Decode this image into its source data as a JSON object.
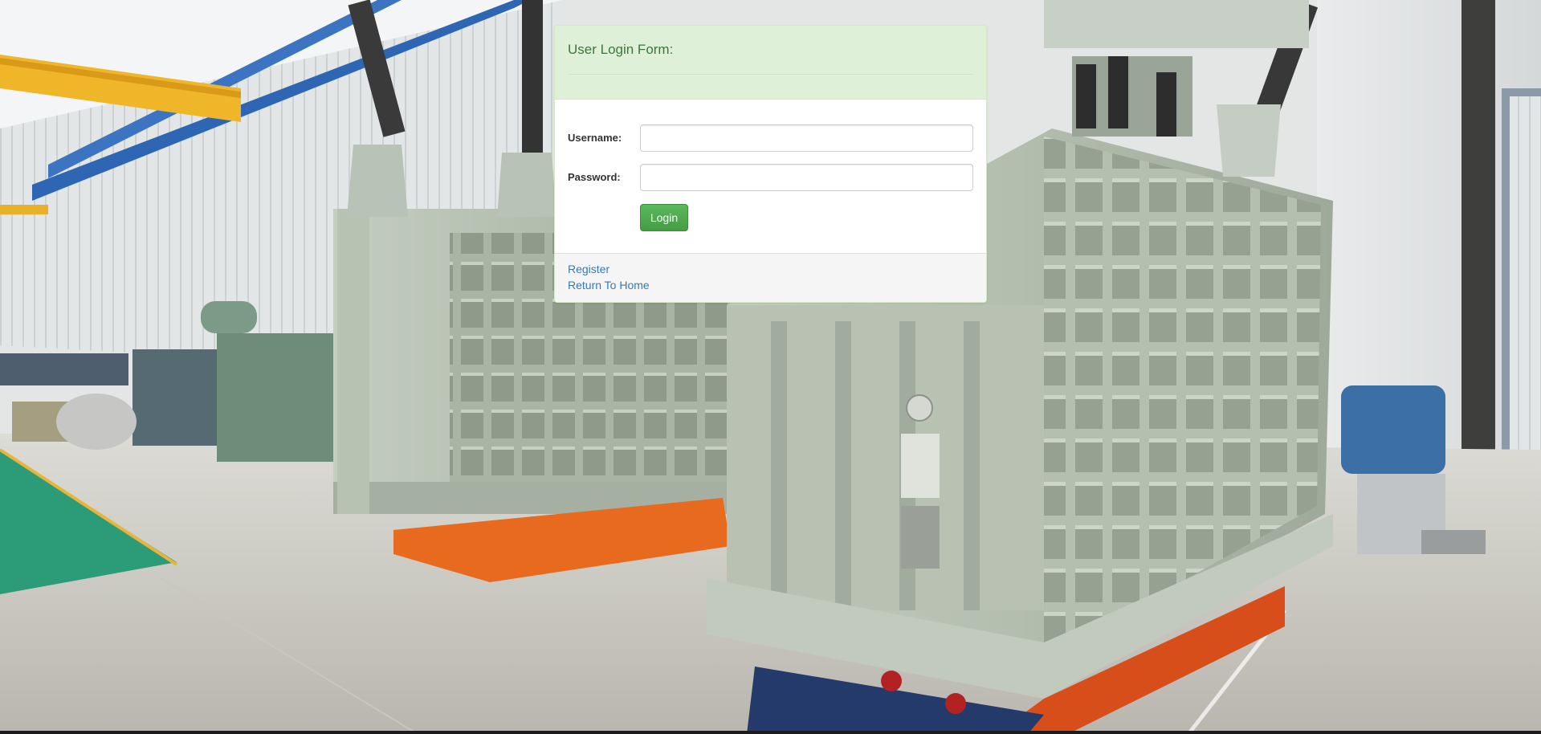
{
  "form": {
    "title": "User Login Form:",
    "username_label": "Username:",
    "username_value": "",
    "password_label": "Password:",
    "password_value": "",
    "login_button": "Login"
  },
  "footer": {
    "links": [
      "Register",
      "Return To Home"
    ]
  },
  "colors": {
    "heading_bg": "#dff0d8",
    "heading_text": "#3c763d",
    "button_green": "#5cb85c",
    "link_blue": "#337ab7"
  },
  "background": {
    "icon": "factory-hall-transformers-photo"
  }
}
